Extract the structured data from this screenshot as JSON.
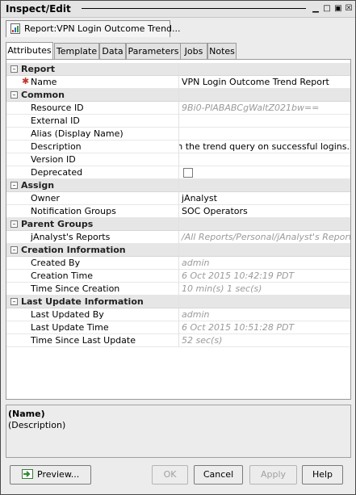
{
  "window": {
    "title": "Inspect/Edit"
  },
  "doc_tab": {
    "label": "Report:VPN Login Outcome Trend..."
  },
  "tabs": [
    "Attributes",
    "Template",
    "Data",
    "Parameters",
    "Jobs",
    "Notes"
  ],
  "groups": {
    "report": {
      "label": "Report",
      "name_label": "Name",
      "name_value": "VPN Login Outcome Trend Report"
    },
    "common": {
      "label": "Common",
      "resource_id_label": "Resource ID",
      "resource_id_value": "9Bi0-PlABABCgWaltZ021bw==",
      "external_id_label": "External ID",
      "alias_label": "Alias (Display Name)",
      "description_label": "Description",
      "description_value": "ed on the trend query on successful logins.",
      "version_id_label": "Version ID",
      "deprecated_label": "Deprecated"
    },
    "assign": {
      "label": "Assign",
      "owner_label": "Owner",
      "owner_value": "jAnalyst",
      "notification_label": "Notification Groups",
      "notification_value": "SOC Operators"
    },
    "parent": {
      "label": "Parent Groups",
      "reports_label": "jAnalyst's Reports",
      "reports_value": "/All Reports/Personal/jAnalyst's Reports/"
    },
    "creation": {
      "label": "Creation Information",
      "created_by_label": "Created By",
      "created_by_value": "admin",
      "creation_time_label": "Creation Time",
      "creation_time_value": "6 Oct 2015 10:42:19 PDT",
      "since_creation_label": "Time Since Creation",
      "since_creation_value": "10 min(s) 1 sec(s)"
    },
    "update": {
      "label": "Last Update Information",
      "updated_by_label": "Last Updated By",
      "updated_by_value": "admin",
      "update_time_label": "Last Update Time",
      "update_time_value": "6 Oct 2015 10:51:28 PDT",
      "since_update_label": "Time Since Last Update",
      "since_update_value": "52 sec(s)"
    }
  },
  "description_pane": {
    "name": "(Name)",
    "description": "(Description)"
  },
  "buttons": {
    "preview": "Preview...",
    "ok": "OK",
    "cancel": "Cancel",
    "apply": "Apply",
    "help": "Help"
  },
  "icons": {
    "report": "report-icon",
    "preview": "preview-icon",
    "collapse": "collapse-icon"
  }
}
